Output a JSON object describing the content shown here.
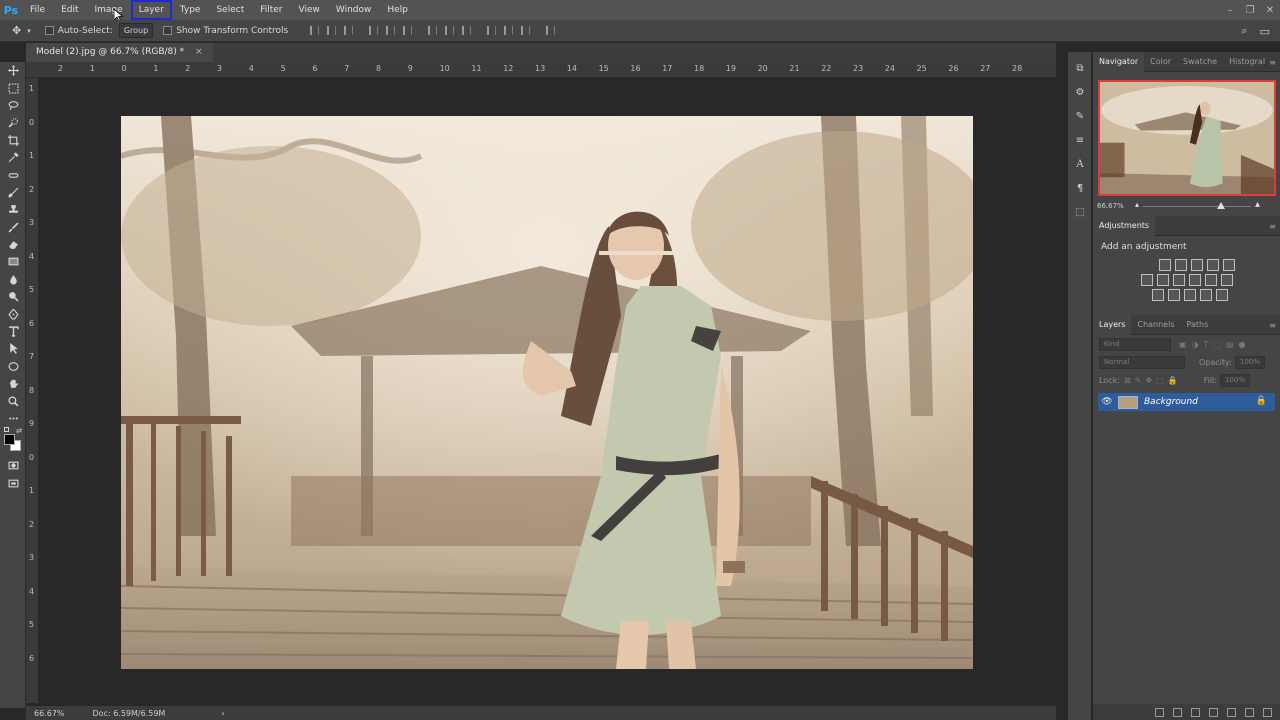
{
  "app": {
    "logo": "Ps"
  },
  "menubar": {
    "items": [
      {
        "label": "File"
      },
      {
        "label": "Edit"
      },
      {
        "label": "Image"
      },
      {
        "label": "Layer"
      },
      {
        "label": "Type"
      },
      {
        "label": "Select"
      },
      {
        "label": "Filter"
      },
      {
        "label": "View"
      },
      {
        "label": "Window"
      },
      {
        "label": "Help"
      }
    ],
    "highlighted": "Layer",
    "window_controls": {
      "minimize": "–",
      "restore": "❐",
      "close": "✕"
    }
  },
  "options_bar": {
    "move_icon": "move-icon",
    "auto_select_label": "Auto-Select:",
    "auto_select_target": "Group",
    "show_transform_label": "Show Transform Controls"
  },
  "document": {
    "tab_title": "Model (2).jpg @ 66.7% (RGB/8) *",
    "close": "×"
  },
  "ruler": {
    "top_ticks": [
      "2",
      "1",
      "0",
      "1",
      "2",
      "3",
      "4",
      "5",
      "6",
      "7",
      "8",
      "9",
      "10",
      "11",
      "12",
      "13",
      "14",
      "15",
      "16",
      "17",
      "18",
      "19",
      "20",
      "21",
      "22",
      "23",
      "24",
      "25",
      "26",
      "27",
      "28"
    ],
    "left_ticks": [
      "1",
      "0",
      "1",
      "2",
      "3",
      "4",
      "5",
      "6",
      "7",
      "8",
      "9",
      "0",
      "1",
      "2",
      "3",
      "4",
      "5",
      "6"
    ]
  },
  "statusbar": {
    "zoom": "66.67%",
    "doc_info": "Doc: 6.59M/6.59M",
    "arrow": "›"
  },
  "navigator_panel": {
    "tabs": [
      "Navigator",
      "Color",
      "Swatche",
      "Histogral"
    ],
    "zoom": "66.67%",
    "zoom_position": 0.72
  },
  "adjustments_panel": {
    "title": "Adjustments",
    "subtitle": "Add an adjustment"
  },
  "layers_panel": {
    "tabs": [
      "Layers",
      "Channels",
      "Paths"
    ],
    "filter_kind": "Kind",
    "blend_mode": "Normal",
    "opacity_label": "Opacity:",
    "opacity_value": "100%",
    "lock_label": "Lock:",
    "fill_label": "Fill:",
    "fill_value": "100%",
    "layers": [
      {
        "name": "Background",
        "visible": true,
        "locked": true
      }
    ]
  },
  "colors": {
    "accent": "#31a8ff",
    "selection": "#2f5c9c",
    "highlight_box": "#1e2ad6"
  }
}
